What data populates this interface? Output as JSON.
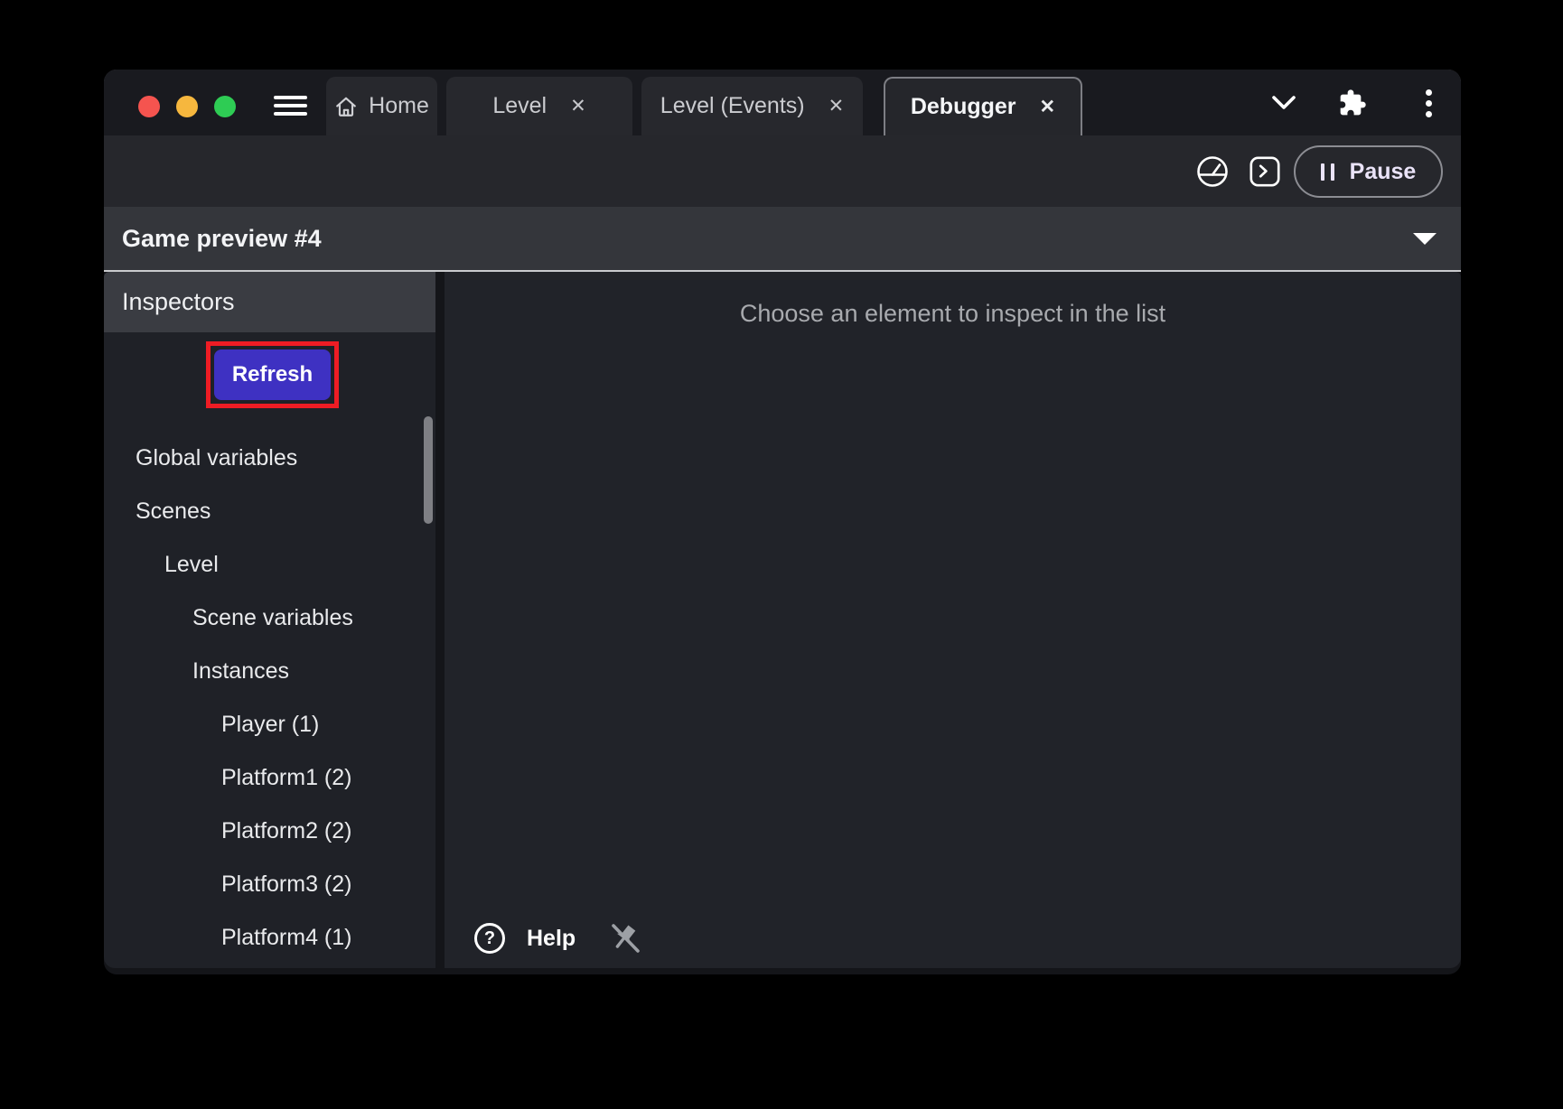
{
  "window": {
    "traffic_lights": [
      "close",
      "minimize",
      "zoom"
    ],
    "close_glyph": "✕",
    "tabs": [
      {
        "label": "Home",
        "active": false,
        "closable": false
      },
      {
        "label": "Level",
        "active": false,
        "closable": true
      },
      {
        "label": "Level (Events)",
        "active": false,
        "closable": true
      },
      {
        "label": "Debugger",
        "active": true,
        "closable": true
      }
    ]
  },
  "toolbar": {
    "pause_label": "Pause",
    "icons": [
      "profiler-gauge",
      "console",
      "pause"
    ]
  },
  "preview_bar": {
    "title": "Game preview #4"
  },
  "sidebar": {
    "header": "Inspectors",
    "refresh_label": "Refresh",
    "tree": [
      {
        "label": "Global variables",
        "depth": 0
      },
      {
        "label": "Scenes",
        "depth": 0
      },
      {
        "label": "Level",
        "depth": 1
      },
      {
        "label": "Scene variables",
        "depth": 2
      },
      {
        "label": "Instances",
        "depth": 2
      },
      {
        "label": "Player (1)",
        "depth": 3
      },
      {
        "label": "Platform1 (2)",
        "depth": 3
      },
      {
        "label": "Platform2 (2)",
        "depth": 3
      },
      {
        "label": "Platform3 (2)",
        "depth": 3
      },
      {
        "label": "Platform4 (1)",
        "depth": 3
      }
    ]
  },
  "main": {
    "empty_message": "Choose an element to inspect in the list",
    "help_label": "Help",
    "help_glyph": "?"
  },
  "colors": {
    "highlight_red": "#ee1c24",
    "refresh_button_indigo": "#3e31c2",
    "pause_text": "#eae3f8",
    "traffic_red": "#f5544f",
    "traffic_yellow": "#f6b73e",
    "traffic_green": "#2ecc54",
    "panel_dark": "#1f2127",
    "header_gray": "#3a3c42"
  }
}
